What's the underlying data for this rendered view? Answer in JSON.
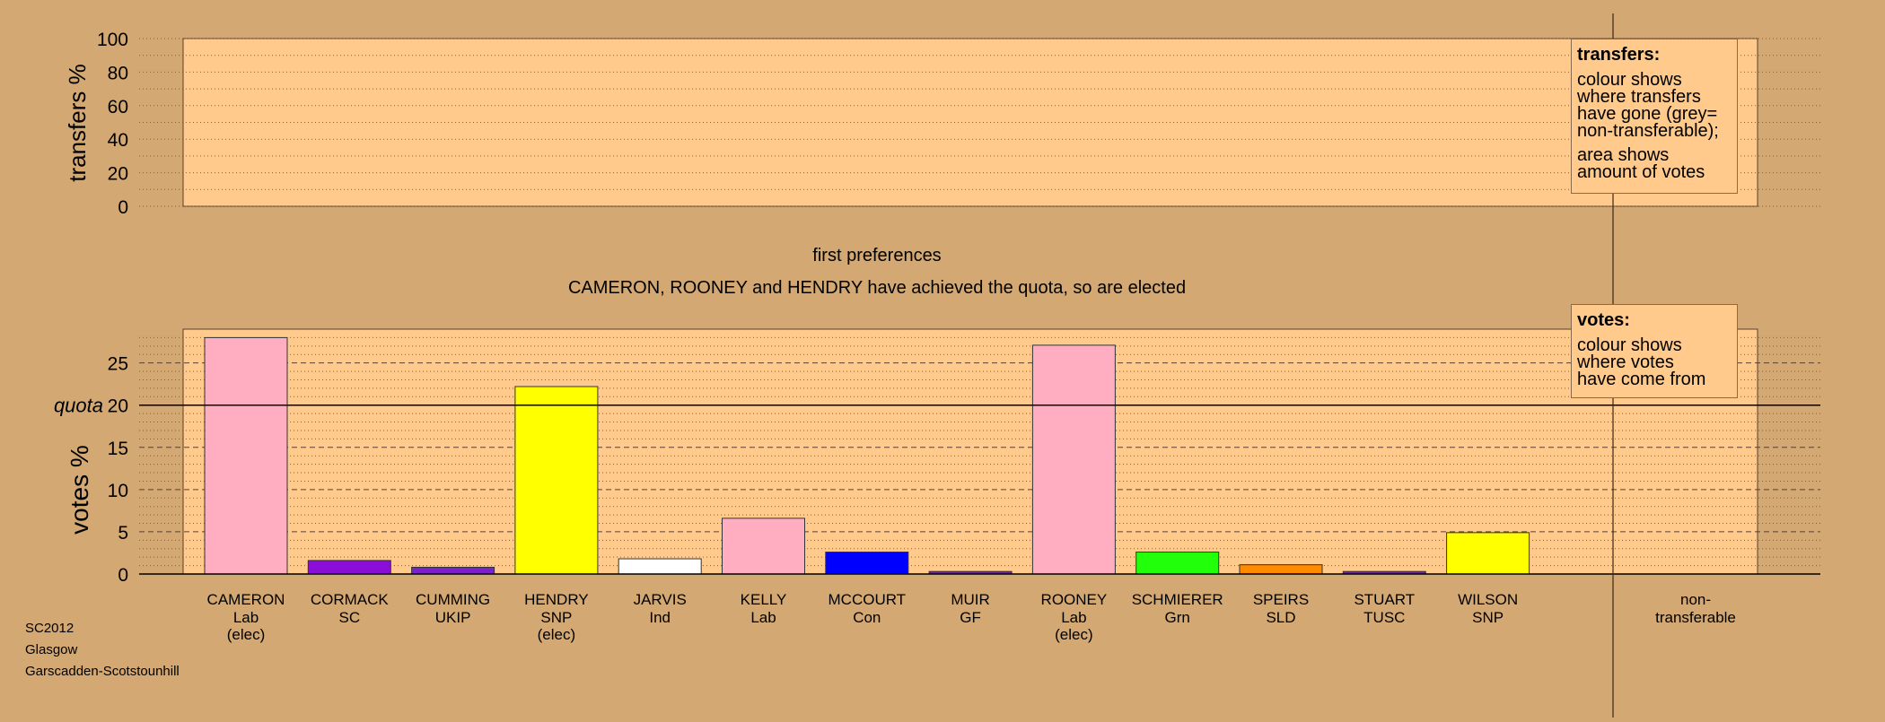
{
  "transfers_panel": {
    "ylabel": "transfers %",
    "ticks": [
      0,
      20,
      40,
      60,
      80,
      100
    ],
    "ylim": [
      0,
      100
    ]
  },
  "stage_title": "first preferences",
  "stage_subtitle": "CAMERON, ROONEY and HENDRY have achieved the quota, so are elected",
  "transfers_box": {
    "title": "transfers:",
    "lines": [
      "colour shows",
      "where transfers",
      "have gone (grey=",
      "non-transferable);"
    ],
    "lines2": [
      "area shows",
      "amount of votes"
    ]
  },
  "votes_box": {
    "title": "votes:",
    "lines": [
      "colour shows",
      "where votes",
      "have come from"
    ]
  },
  "quota_label": "quota",
  "footer": [
    "SC2012",
    "Glasgow",
    "Garscadden-Scotstounhill"
  ],
  "colors": {
    "background": "#d3a872",
    "plot_fill": "#ffca8c",
    "Lab": "#ffadc0",
    "SC": "#8a0ed8",
    "UKIP": "#7a22c8",
    "SNP": "#ffff00",
    "Ind": "#ffffff",
    "Con": "#0000ff",
    "GF": "#6a2a9a",
    "Grn": "#22ff0a",
    "SLD": "#ff8a00",
    "TUSC": "#6a2a9a"
  },
  "chart_data": {
    "type": "bar",
    "ylabel": "votes %",
    "ylim": [
      0,
      29
    ],
    "yticks": [
      0,
      5,
      10,
      15,
      20,
      25
    ],
    "quota": 20,
    "candidates": [
      {
        "name": "CAMERON",
        "party": "Lab",
        "note": "(elec)",
        "value": 28.0
      },
      {
        "name": "CORMACK",
        "party": "SC",
        "note": "",
        "value": 1.6
      },
      {
        "name": "CUMMING",
        "party": "UKIP",
        "note": "",
        "value": 0.8
      },
      {
        "name": "HENDRY",
        "party": "SNP",
        "note": "(elec)",
        "value": 22.2
      },
      {
        "name": "JARVIS",
        "party": "Ind",
        "note": "",
        "value": 1.8
      },
      {
        "name": "KELLY",
        "party": "Lab",
        "note": "",
        "value": 6.6
      },
      {
        "name": "MCCOURT",
        "party": "Con",
        "note": "",
        "value": 2.6
      },
      {
        "name": "MUIR",
        "party": "GF",
        "note": "",
        "value": 0.3
      },
      {
        "name": "ROONEY",
        "party": "Lab",
        "note": "(elec)",
        "value": 27.1
      },
      {
        "name": "SCHMIERER",
        "party": "Grn",
        "note": "",
        "value": 2.6
      },
      {
        "name": "SPEIRS",
        "party": "SLD",
        "note": "",
        "value": 1.1
      },
      {
        "name": "STUART",
        "party": "TUSC",
        "note": "",
        "value": 0.3
      },
      {
        "name": "WILSON",
        "party": "SNP",
        "note": "",
        "value": 4.9
      }
    ],
    "nontransferable_label": [
      "non-",
      "transferable"
    ]
  }
}
